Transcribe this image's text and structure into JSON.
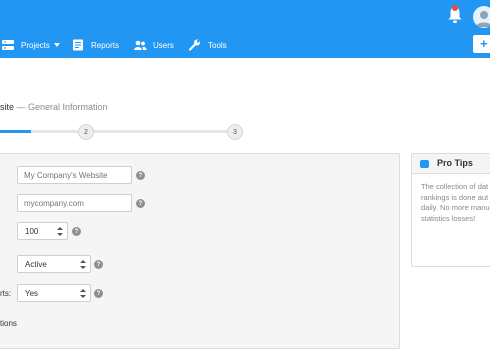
{
  "header": {
    "nav": [
      {
        "label": "Projects",
        "icon": "server-icon",
        "has_dropdown": true
      },
      {
        "label": "Reports",
        "icon": "report-icon"
      },
      {
        "label": "Users",
        "icon": "users-icon"
      },
      {
        "label": "Tools",
        "icon": "wrench-icon"
      }
    ],
    "add_button_glyph": "+"
  },
  "wizard": {
    "title_partial": "site",
    "title_separator": " — ",
    "step_title": "General Information",
    "steps": [
      "2",
      "3"
    ],
    "progress_fraction": 0.13
  },
  "form": {
    "website_name": {
      "placeholder": "My Company's Website",
      "value": ""
    },
    "url": {
      "placeholder": "mycompany.com",
      "value": ""
    },
    "frequency": {
      "value": "100"
    },
    "status": {
      "value": "Active"
    },
    "reports": {
      "label_partial": "rts:",
      "value": "Yes"
    },
    "options_label_partial": "tions"
  },
  "tips": {
    "title": "Pro Tips",
    "lines": [
      "The collection of dat",
      "rankings is done aut",
      "daily. No more manu",
      "statistics losses!"
    ]
  },
  "colors": {
    "primary": "#2196f3",
    "notification": "#e74c3c"
  }
}
